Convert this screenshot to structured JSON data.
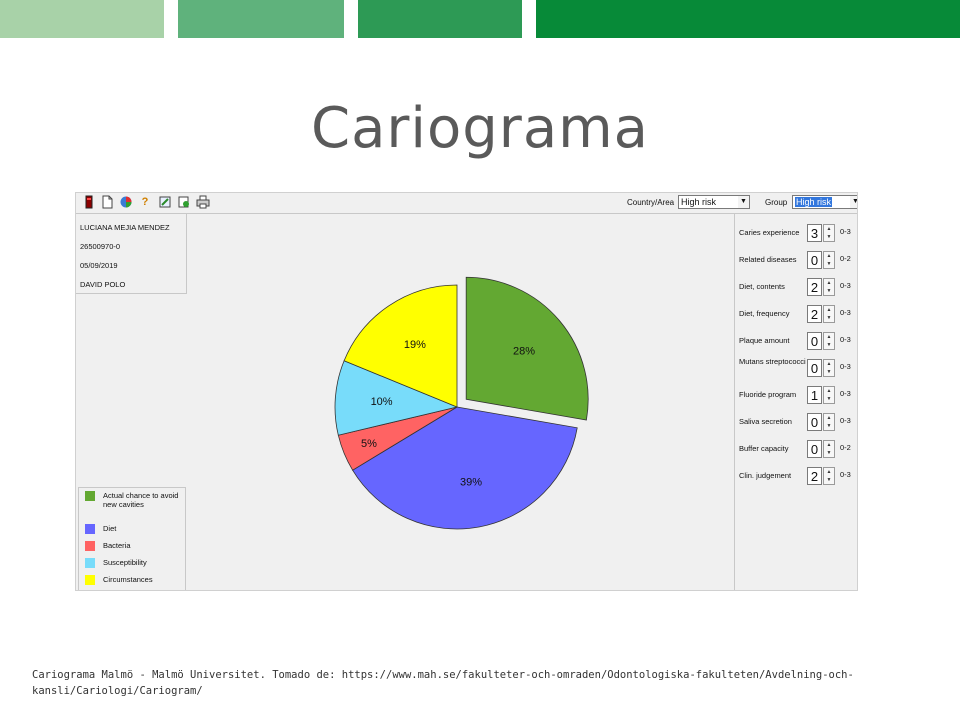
{
  "slide": {
    "title": "Cariograma",
    "caption": "Cariograma Malmö - Malmö Universitet.  Tomado de: https://www.mah.se/fakulteter-och-omraden/Odontologiska-fakulteten/Avdelning-och-kansli/Cariologi/Cariogram/",
    "bar_colors": [
      "#a8d2a8",
      "#5fb27c",
      "#2d9a55",
      "#078a38"
    ]
  },
  "toolbar": {
    "icons": [
      "exit-icon",
      "new-file-icon",
      "chart-icon",
      "help-icon",
      "edit-icon",
      "report-icon",
      "print-icon"
    ],
    "country_label": "Country/Area",
    "country_value": "High risk",
    "group_label": "Group",
    "group_value": "High risk"
  },
  "patient": {
    "name": "LUCIANA MEJIA MENDEZ",
    "id": "26500970-0",
    "date": "05/09/2019",
    "examiner": "DAVID POLO"
  },
  "chart_data": {
    "type": "pie",
    "slices": [
      {
        "name": "Actual chance to avoid new cavities",
        "value": 28,
        "label": "28%",
        "color": "#63a832",
        "exploded": true
      },
      {
        "name": "Diet",
        "value": 39,
        "label": "39%",
        "color": "#6666ff",
        "exploded": false
      },
      {
        "name": "Bacteria",
        "value": 5,
        "label": "5%",
        "color": "#ff6363",
        "exploded": false
      },
      {
        "name": "Susceptibility",
        "value": 10,
        "label": "10%",
        "color": "#78dcfa",
        "exploded": false
      },
      {
        "name": "Circumstances",
        "value": 19,
        "label": "19%",
        "color": "#ffff00",
        "exploded": false
      }
    ],
    "start_angle_deg": 0,
    "direction": "clockwise"
  },
  "factors": [
    {
      "label": "Caries experience",
      "value": "3",
      "range": "0-3"
    },
    {
      "label": "Related diseases",
      "value": "0",
      "range": "0-2"
    },
    {
      "label": "Diet, contents",
      "value": "2",
      "range": "0-3"
    },
    {
      "label": "Diet, frequency",
      "value": "2",
      "range": "0-3"
    },
    {
      "label": "Plaque amount",
      "value": "0",
      "range": "0-3"
    },
    {
      "label": "Mutans streptococci",
      "value": "0",
      "range": "0-3"
    },
    {
      "label": "Fluoride program",
      "value": "1",
      "range": "0-3"
    },
    {
      "label": "Saliva secretion",
      "value": "0",
      "range": "0-3"
    },
    {
      "label": "Buffer capacity",
      "value": "0",
      "range": "0-2"
    },
    {
      "label": "Clin. judgement",
      "value": "2",
      "range": "0-3"
    }
  ]
}
